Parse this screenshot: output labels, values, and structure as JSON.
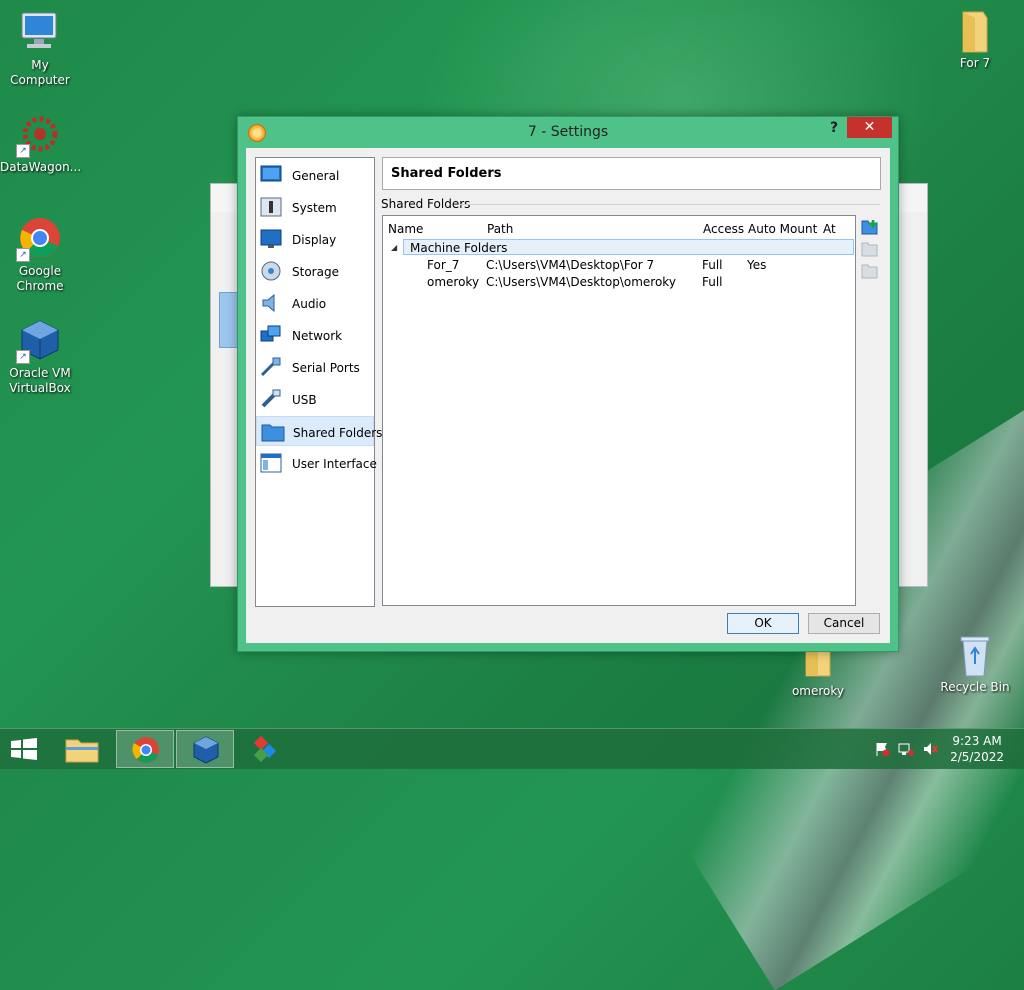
{
  "desktop": {
    "icons": [
      {
        "label": "My Computer"
      },
      {
        "label": "DataWagon..."
      },
      {
        "label": "Google\nChrome"
      },
      {
        "label": "Oracle VM\nVirtualBox"
      },
      {
        "label": "For 7"
      },
      {
        "label": "omeroky"
      },
      {
        "label": "Recycle Bin"
      }
    ]
  },
  "dialog": {
    "title": "7 - Settings",
    "help": "?",
    "close": "✕",
    "sidebar": [
      {
        "label": "General",
        "icon": "general-icon"
      },
      {
        "label": "System",
        "icon": "system-icon"
      },
      {
        "label": "Display",
        "icon": "display-icon"
      },
      {
        "label": "Storage",
        "icon": "storage-icon"
      },
      {
        "label": "Audio",
        "icon": "audio-icon"
      },
      {
        "label": "Network",
        "icon": "network-icon"
      },
      {
        "label": "Serial Ports",
        "icon": "serial-ports-icon"
      },
      {
        "label": "USB",
        "icon": "usb-icon"
      },
      {
        "label": "Shared Folders",
        "icon": "shared-folders-icon",
        "selected": true
      },
      {
        "label": "User Interface",
        "icon": "user-interface-icon"
      }
    ],
    "page_title": "Shared Folders",
    "group_label": "Shared Folders",
    "columns": {
      "name": "Name",
      "path": "Path",
      "access": "Access",
      "auto_mount": "Auto Mount",
      "at": "At"
    },
    "machine_folders_label": "Machine Folders",
    "folders": [
      {
        "name": "For_7",
        "path": "C:\\Users\\VM4\\Desktop\\For 7",
        "access": "Full",
        "auto_mount": "Yes",
        "at": ""
      },
      {
        "name": "omeroky",
        "path": "C:\\Users\\VM4\\Desktop\\omeroky",
        "access": "Full",
        "auto_mount": "",
        "at": ""
      }
    ],
    "ok": "OK",
    "cancel": "Cancel"
  },
  "taskbar": {
    "time": "9:23 AM",
    "date": "2/5/2022"
  },
  "colors": {
    "accent": "#4fc28a",
    "close_red": "#c7312d",
    "selection": "#dcebfc"
  }
}
